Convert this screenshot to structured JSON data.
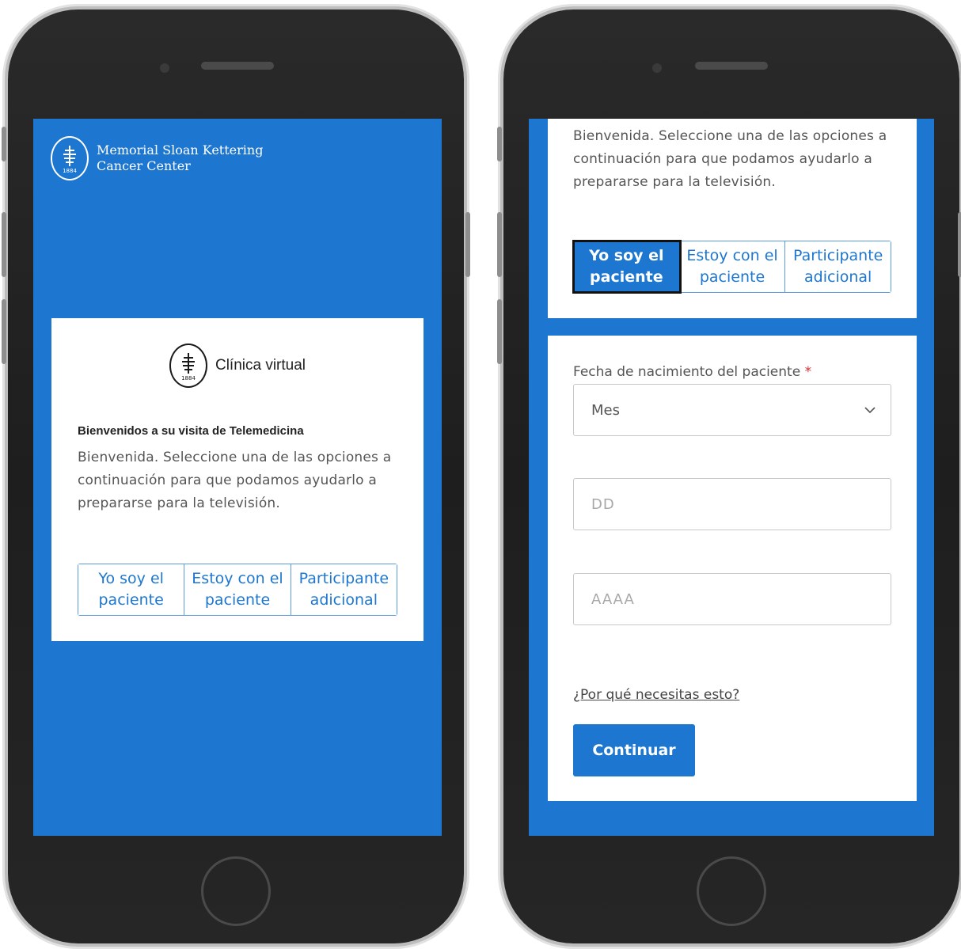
{
  "brand": {
    "name_line1": "Memorial Sloan Kettering",
    "name_line2": "Cancer Center",
    "year": "1884"
  },
  "left_card": {
    "title": "Clínica virtual",
    "welcome_heading": "Bienvenidos a su visita de Telemedicina",
    "welcome_body": "Bienvenida. Seleccione una de las opciones a continuación para que podamos ayudarlo a prepararse para la televisión.",
    "options": [
      "Yo soy el paciente",
      "Estoy con el paciente",
      "Participante adicional"
    ]
  },
  "right_top": {
    "welcome_body": "Bienvenida. Seleccione una de las opciones a continuación para que podamos ayudarlo a prepararse para la televisión.",
    "options": [
      "Yo soy el paciente",
      "Estoy con el paciente",
      "Participante adicional"
    ],
    "selected_option": "Yo soy el paciente"
  },
  "dob_form": {
    "label": "Fecha de nacimiento del paciente",
    "required_mark": "*",
    "month_value": "Mes",
    "day_placeholder": "DD",
    "year_placeholder": "AAAA",
    "why_link": "¿Por qué necesitas esto?",
    "continue_label": "Continuar"
  },
  "colors": {
    "brand_blue": "#1d76cf",
    "required_red": "#d32f2f"
  }
}
